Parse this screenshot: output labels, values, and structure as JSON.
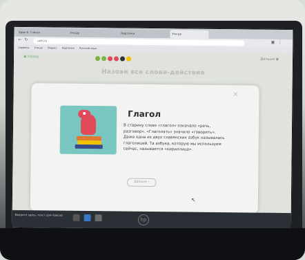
{
  "browser": {
    "tabs": [
      {
        "label": "Урок 6. Глагол",
        "active": false
      },
      {
        "label": "Учи.ру",
        "active": false
      },
      {
        "label": "Карточки",
        "active": false
      },
      {
        "label": "Учи.ру",
        "active": true
      }
    ],
    "url": "uchi.ru",
    "bookmarks": [
      "Сервисы",
      "Учи.ру",
      "Яндекс",
      "Карточки",
      "Русский язык"
    ]
  },
  "app": {
    "back_label": "Назад",
    "next_label": "Дальше",
    "progress_colors": [
      "#7cb342",
      "#7cb342",
      "#e04a5a",
      "#e04a5a",
      "#333333",
      "#f2c200"
    ],
    "task_title": "Назови все слова-действия",
    "modal": {
      "heading": "Глагол",
      "paragraph": "В старину слово «глагол» означало «речь, разговор». «Глаголать» значило «говорить». Даже одна из двух славянских азбук называлась глаголицей. Та азбука, которую мы используем сейчас, называется «кириллица».",
      "more_label": "Дальше ›",
      "close_symbol": "×"
    }
  },
  "taskbar": {
    "text": "Введите здесь текст для поиска"
  },
  "laptop": {
    "logo_text": "hp"
  }
}
